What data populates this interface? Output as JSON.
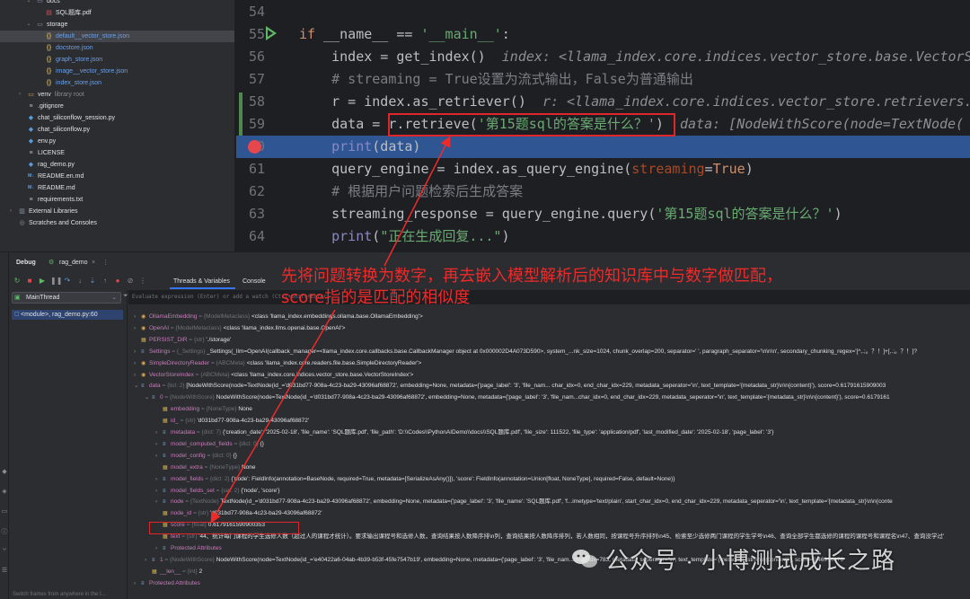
{
  "project_tree": {
    "rows": [
      {
        "label": "docs",
        "kind": "folder"
      },
      {
        "label": "SQL题库.pdf",
        "kind": "pdf"
      },
      {
        "label": "storage",
        "kind": "folder"
      },
      {
        "label": "default__vector_store.json",
        "kind": "json"
      },
      {
        "label": "docstore.json",
        "kind": "json"
      },
      {
        "label": "graph_store.json",
        "kind": "json"
      },
      {
        "label": "image__vector_store.json",
        "kind": "json"
      },
      {
        "label": "index_store.json",
        "kind": "json"
      },
      {
        "label": "venv",
        "kind": "venv",
        "note": "library root"
      },
      {
        "label": ".gitignore",
        "kind": "txt"
      },
      {
        "label": "chat_siliconflow_session.py",
        "kind": "py"
      },
      {
        "label": "chat_siliconflow.py",
        "kind": "py"
      },
      {
        "label": "env.py",
        "kind": "py"
      },
      {
        "label": "LICENSE",
        "kind": "txt"
      },
      {
        "label": "rag_demo.py",
        "kind": "py"
      },
      {
        "label": "README.en.md",
        "kind": "md"
      },
      {
        "label": "README.md",
        "kind": "md"
      },
      {
        "label": "requirements.txt",
        "kind": "txt"
      },
      {
        "label": "External Libraries",
        "kind": "lib"
      },
      {
        "label": "Scratches and Consoles",
        "kind": "scratch"
      }
    ]
  },
  "editor": {
    "lines": [
      {
        "num": "54",
        "segments": []
      },
      {
        "num": "55",
        "segments": [
          {
            "t": "if",
            "c": "kw"
          },
          {
            "t": " __name__ == ",
            "c": ""
          },
          {
            "t": "'__main__'",
            "c": "str"
          },
          {
            "t": ":",
            "c": ""
          }
        ]
      },
      {
        "num": "56",
        "segments": [
          {
            "t": "    index = ",
            "c": ""
          },
          {
            "t": "get_index",
            "c": ""
          },
          {
            "t": "()  ",
            "c": ""
          },
          {
            "t": "index: <llama_index.core.indices.vector_store.base.VectorS",
            "c": "hint"
          }
        ]
      },
      {
        "num": "57",
        "segments": [
          {
            "t": "    # streaming = True设置为流式输出，False为普通输出",
            "c": "cmt"
          }
        ]
      },
      {
        "num": "58",
        "segments": [
          {
            "t": "    r = index.as_retriever()  ",
            "c": ""
          },
          {
            "t": "r: <llama_index.core.indices.vector_store.retrievers.",
            "c": "hint"
          }
        ]
      },
      {
        "num": "59",
        "segments": [
          {
            "t": "    data = r.retrieve(",
            "c": ""
          },
          {
            "t": "'第15题sql的答案是什么？'",
            "c": "str"
          },
          {
            "t": ")  ",
            "c": ""
          },
          {
            "t": "data: [NodeWithScore(node=TextNode(",
            "c": "hint"
          }
        ]
      },
      {
        "num": "60",
        "segments": [
          {
            "t": "    ",
            "c": ""
          },
          {
            "t": "print",
            "c": "fnc-print"
          },
          {
            "t": "(data)",
            "c": ""
          }
        ]
      },
      {
        "num": "61",
        "segments": [
          {
            "t": "    query_engine = index.as_query_engine(",
            "c": ""
          },
          {
            "t": "streaming",
            "c": "prm"
          },
          {
            "t": "=",
            "c": ""
          },
          {
            "t": "True",
            "c": "kw"
          },
          {
            "t": ")",
            "c": ""
          }
        ]
      },
      {
        "num": "62",
        "segments": [
          {
            "t": "    # 根据用户问题检索后生成答案",
            "c": "cmt"
          }
        ]
      },
      {
        "num": "63",
        "segments": [
          {
            "t": "    streaming_response = query_engine.query(",
            "c": ""
          },
          {
            "t": "'第15题sql的答案是什么？'",
            "c": "str"
          },
          {
            "t": ")",
            "c": ""
          }
        ]
      },
      {
        "num": "64",
        "segments": [
          {
            "t": "    ",
            "c": ""
          },
          {
            "t": "print",
            "c": "fnc-print"
          },
          {
            "t": "(",
            "c": ""
          },
          {
            "t": "\"正在生成回复...\"",
            "c": "str"
          },
          {
            "t": ")",
            "c": ""
          }
        ]
      }
    ]
  },
  "debug": {
    "title": "Debug",
    "config_tab": "rag_demo",
    "threads_tab": "Threads & Variables",
    "console_tab": "Console",
    "thread_name": "MainThread",
    "frame": "<module>, rag_demo.py:60",
    "eval_placeholder": "Evaluate expression (Enter) or add a watch (Ctrl+Shift+Enter)",
    "frames_footer": "Switch frames from anywhere in the I...",
    "variables": [
      {
        "indent": 0,
        "exp": "›",
        "name": "OllamaEmbedding",
        "type": "{ModelMetaclass}",
        "value": "<class 'llama_index.embeddings.ollama.base.OllamaEmbedding'>"
      },
      {
        "indent": 0,
        "exp": "›",
        "name": "OpenAI",
        "type": "{ModelMetaclass}",
        "value": "<class 'llama_index.llms.openai.base.OpenAI'>"
      },
      {
        "indent": 0,
        "exp": "",
        "name": "PERSIST_DIR",
        "type": "{str}",
        "value": "'./storage'"
      },
      {
        "indent": 0,
        "exp": "›",
        "name": "Settings",
        "type": "{_Settings}",
        "value": "_Settings(_llm=OpenAI(callback_manager=<llama_index.core.callbacks.base.CallbackManager object at 0x000002D4A073D590>, system_...nk_size=1024, chunk_overlap=200, separator=' ', paragraph_separator='\\n\\n\\n', secondary_chunking_regex='[^,.;。？！]+[,.;。？！]?"
      },
      {
        "indent": 0,
        "exp": "›",
        "name": "SimpleDirectoryReader",
        "type": "{ABCMeta}",
        "value": "<class 'llama_index.core.readers.file.base.SimpleDirectoryReader'>"
      },
      {
        "indent": 0,
        "exp": "›",
        "name": "VectorStoreIndex",
        "type": "{ABCMeta}",
        "value": "<class 'llama_index.core.indices.vector_store.base.VectorStoreIndex'>"
      },
      {
        "indent": 0,
        "exp": "⌄",
        "name": "data",
        "type": "{list: 2}",
        "value": "[NodeWithScore(node=TextNode(id_='d031bd77-908a-4c23-ba29-43096af68872', embedding=None, metadata={'page_label': '3', 'file_nam... char_idx=0, end_char_idx=229, metadata_seperator='\\n', text_template='{metadata_str}\\n\\n{content}'), score=0.61791615909003"
      },
      {
        "indent": 1,
        "exp": "⌄",
        "name": "0",
        "type": "{NodeWithScore}",
        "value": "NodeWithScore(node=TextNode(id_='d031bd77-908a-4c23-ba29-43096af68872', embedding=None, metadata={'page_label': '3', 'file_nam...char_idx=0, end_char_idx=229, metadata_seperator='\\n', text_template='{metadata_str}\\n\\n{content}'), score=0.6179161"
      },
      {
        "indent": 2,
        "exp": "",
        "name": "embedding",
        "type": "{NoneType}",
        "value": "None"
      },
      {
        "indent": 2,
        "exp": "",
        "name": "id_",
        "type": "{str}",
        "value": "'d031bd77-908a-4c23-ba29-43096af68872'"
      },
      {
        "indent": 2,
        "exp": "›",
        "name": "metadata",
        "type": "{dict: 7}",
        "value": "{'creation_date': '2025-02-18', 'file_name': 'SQL题库.pdf', 'file_path': 'D:\\\\Codes\\\\PythonAIDemo\\\\docs\\\\SQL题库.pdf', 'file_size': 111522, 'file_type': 'application/pdf', 'last_modified_date': '2025-02-18', 'page_label': '3'}"
      },
      {
        "indent": 2,
        "exp": "›",
        "name": "model_computed_fields",
        "type": "{dict: 0}",
        "value": "{}"
      },
      {
        "indent": 2,
        "exp": "›",
        "name": "model_config",
        "type": "{dict: 0}",
        "value": "{}"
      },
      {
        "indent": 2,
        "exp": "",
        "name": "model_extra",
        "type": "{NoneType}",
        "value": "None"
      },
      {
        "indent": 2,
        "exp": "›",
        "name": "model_fields",
        "type": "{dict: 2}",
        "value": "{'node': FieldInfo(annotation=BaseNode, required=True, metadata=[SerializeAsAny()]), 'score': FieldInfo(annotation=Union[float, NoneType], required=False, default=None)}"
      },
      {
        "indent": 2,
        "exp": "›",
        "name": "model_fields_set",
        "type": "{set: 2}",
        "value": "{'node', 'score'}"
      },
      {
        "indent": 2,
        "exp": "›",
        "name": "node",
        "type": "{TextNode}",
        "value": "TextNode(id_='d031bd77-908a-4c23-ba29-43096af68872', embedding=None, metadata={'page_label': '3', 'file_name': 'SQL题库.pdf', 'f...imetype='text/plain', start_char_idx=0, end_char_idx=229, metadata_seperator='\\n', text_template='{metadata_str}\\n\\n{conte"
      },
      {
        "indent": 2,
        "exp": "",
        "name": "node_id",
        "type": "{str}",
        "value": "'d031bd77-908a-4c23-ba29-43096af68872'"
      },
      {
        "indent": 2,
        "exp": "",
        "name": "score",
        "type": "{float}",
        "value": "0.6179161590900353"
      },
      {
        "indent": 2,
        "exp": "",
        "name": "text",
        "type": "{str}",
        "value": "'44、统计每门课程的学生选修人数（超过人的课程才统计）。要求输出课程号和选修人数，查询结果按人数降序排\\n列，查询结果按人数降序排列，若人数相同，按课程号升序排列\\n45、检索至少选修两门课程的学生学号\\n46、查询全部学生都选修的课程的课程号和课程名\\n47、查询没学过'"
      },
      {
        "indent": 2,
        "exp": "›",
        "name": "Protected Attributes",
        "type": "",
        "value": ""
      },
      {
        "indent": 1,
        "exp": "›",
        "name": "1",
        "type": "{NodeWithScore}",
        "value": "NodeWithScore(node=TextNode(id_='e40422a6-04ab-4b39-b53f-45fe7547b19', embedding=None, metadata={'page_label': '3', 'file_nam...char_idx=783, metadata_seperator='\\n', text_template='{metadata_str}\\n\\n{content}'), score=0.46916076"
      },
      {
        "indent": 1,
        "exp": "",
        "name": "__len__",
        "type": "{int}",
        "value": "2"
      },
      {
        "indent": 0,
        "exp": "›",
        "name": "Protected Attributes",
        "type": "",
        "value": ""
      }
    ]
  },
  "annotation": {
    "line1": "先将问题转换为数字，再去嵌入模型解析后的知识库中与数字做匹配，",
    "line2": "score指的是匹配的相似度",
    "color": "#ef2a2a"
  },
  "watermark": {
    "text": "公众号 · 小博测试成长之路"
  }
}
